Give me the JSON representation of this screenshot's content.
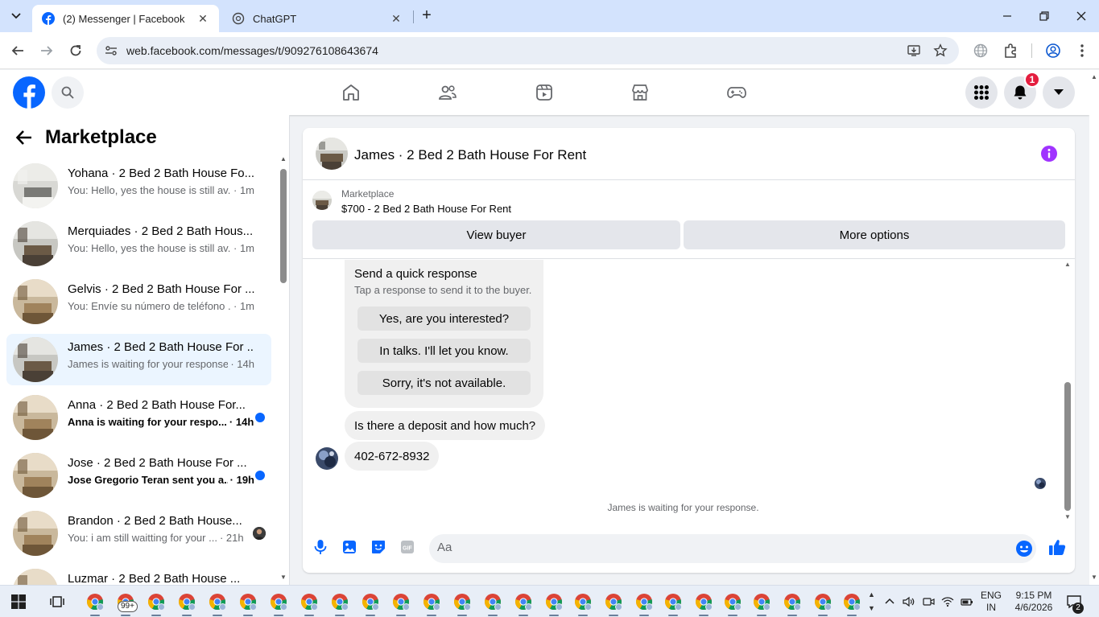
{
  "browser": {
    "tabs": [
      {
        "title": "(2) Messenger | Facebook",
        "active": true
      },
      {
        "title": "ChatGPT",
        "active": false
      }
    ],
    "url": "web.facebook.com/messages/t/909276108643674"
  },
  "header": {
    "notification_count": "1",
    "nav_icons": [
      "home-icon",
      "friends-icon",
      "video-icon",
      "marketplace-icon",
      "gaming-icon"
    ]
  },
  "sidebar": {
    "title": "Marketplace",
    "conversations": [
      {
        "name": "Yohana · 2 Bed 2 Bath House Fo...",
        "snippet": "You: Hello, yes the house is still av...",
        "time": "· 1m",
        "unread": false,
        "active": false
      },
      {
        "name": "Merquiades · 2 Bed 2 Bath Hous...",
        "snippet": "You: Hello, yes the house is still av...",
        "time": "· 1m",
        "unread": false,
        "active": false
      },
      {
        "name": "Gelvis · 2 Bed 2 Bath House For ...",
        "snippet": "You: Envíe su número de teléfono ...",
        "time": "· 1m",
        "unread": false,
        "active": false
      },
      {
        "name": "James · 2 Bed 2 Bath House For ...",
        "snippet": "James is waiting for your response.",
        "time": "· 14h",
        "unread": false,
        "active": true
      },
      {
        "name": "Anna · 2 Bed 2 Bath House For...",
        "snippet": "Anna is waiting for your respo...",
        "time": "· 14h",
        "unread": true,
        "active": false
      },
      {
        "name": "Jose · 2 Bed 2 Bath House For ...",
        "snippet": "Jose Gregorio Teran sent you a...",
        "time": "· 19h",
        "unread": true,
        "active": false
      },
      {
        "name": "Brandon · 2 Bed 2 Bath House...",
        "snippet": "You: i am still waitting for your ...",
        "time": "· 21h",
        "unread": false,
        "active": false
      },
      {
        "name": "Luzmar · 2 Bed 2 Bath House ...",
        "snippet": "",
        "time": "",
        "unread": false,
        "active": false
      }
    ]
  },
  "chat": {
    "title": "James · 2 Bed 2 Bath House For Rent",
    "marketplace_label": "Marketplace",
    "listing": "$700 - 2 Bed 2 Bath House For Rent",
    "view_buyer": "View buyer",
    "more_options": "More options",
    "quick_response": {
      "title": "Send a quick response",
      "subtitle": "Tap a response to send it to the buyer.",
      "options": [
        "Yes, are you interested?",
        "In talks. I'll let you know.",
        "Sorry, it's not available."
      ]
    },
    "messages": [
      "Is there a deposit and how much?",
      "402-672-8932"
    ],
    "waiting_text": "James is waiting for your response.",
    "composer_placeholder": "Aa"
  },
  "taskbar": {
    "chrome_badge": "99+",
    "language": "ENG",
    "region": "IN",
    "time": "9:15 PM",
    "date": "4/6/2026",
    "notifications": "2"
  },
  "colors": {
    "facebook_blue": "#0866ff",
    "messenger_purple": "#a033ff",
    "unread_dot": "#0866ff",
    "badge_red": "#e41e3f"
  }
}
